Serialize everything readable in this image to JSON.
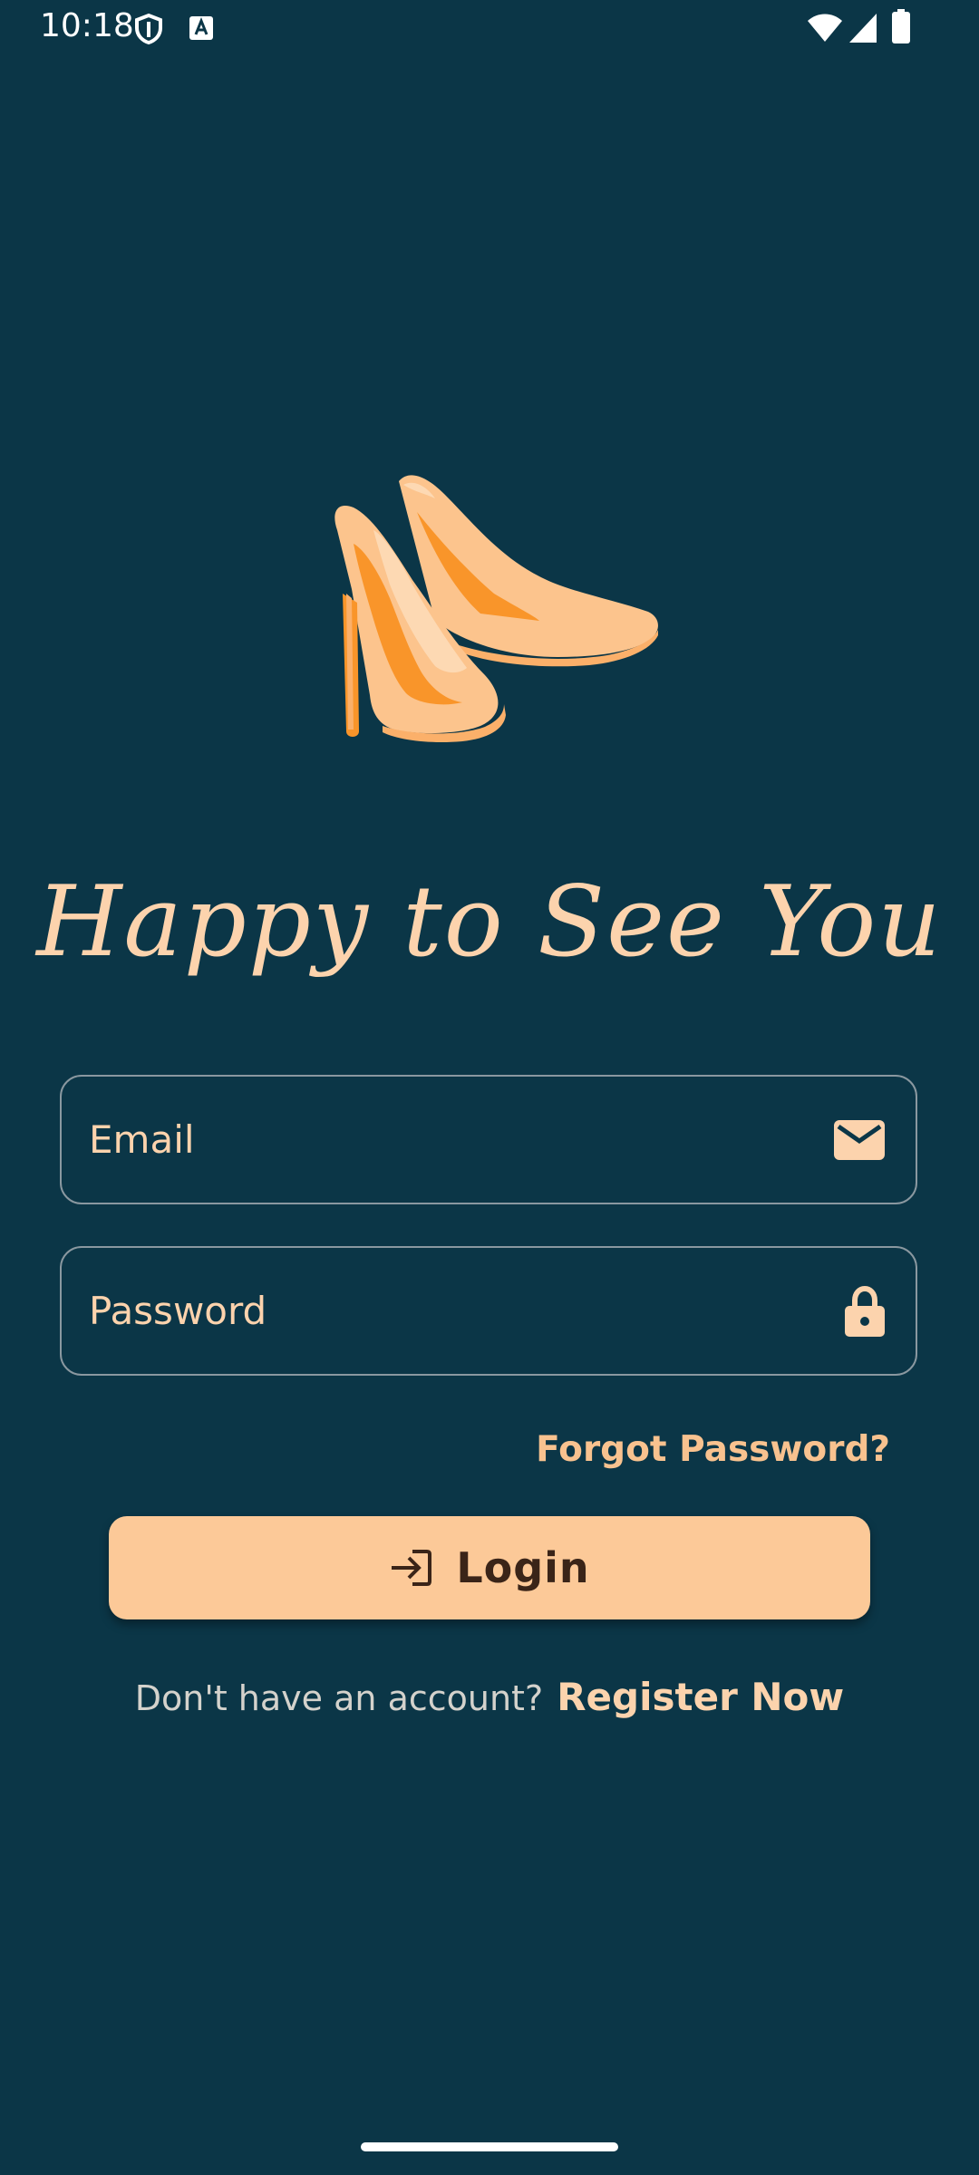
{
  "status_bar": {
    "time": "10:18",
    "icons": [
      "shield-icon",
      "keyboard-a-icon",
      "wifi-icon",
      "signal-icon",
      "battery-icon"
    ]
  },
  "illustration": {
    "name": "high-heel-shoes",
    "colors": {
      "light": "#fdc48e",
      "mid": "#fbb06a",
      "accent": "#f9952a",
      "inner": "#fdd9b3"
    }
  },
  "headline": "Happy to See You",
  "form": {
    "email": {
      "placeholder": "Email",
      "value": "",
      "icon": "mail-icon"
    },
    "password": {
      "placeholder": "Password",
      "value": "",
      "icon": "lock-icon"
    },
    "forgot_label": "Forgot Password?",
    "login_label": "Login",
    "login_icon": "login-icon"
  },
  "register": {
    "prompt": "Don't have an account?",
    "link_label": "Register Now"
  },
  "colors": {
    "background": "#0b3647",
    "accent": "#fcc998",
    "text_light": "#fcd3ad",
    "field_border": "#8a98a0"
  }
}
